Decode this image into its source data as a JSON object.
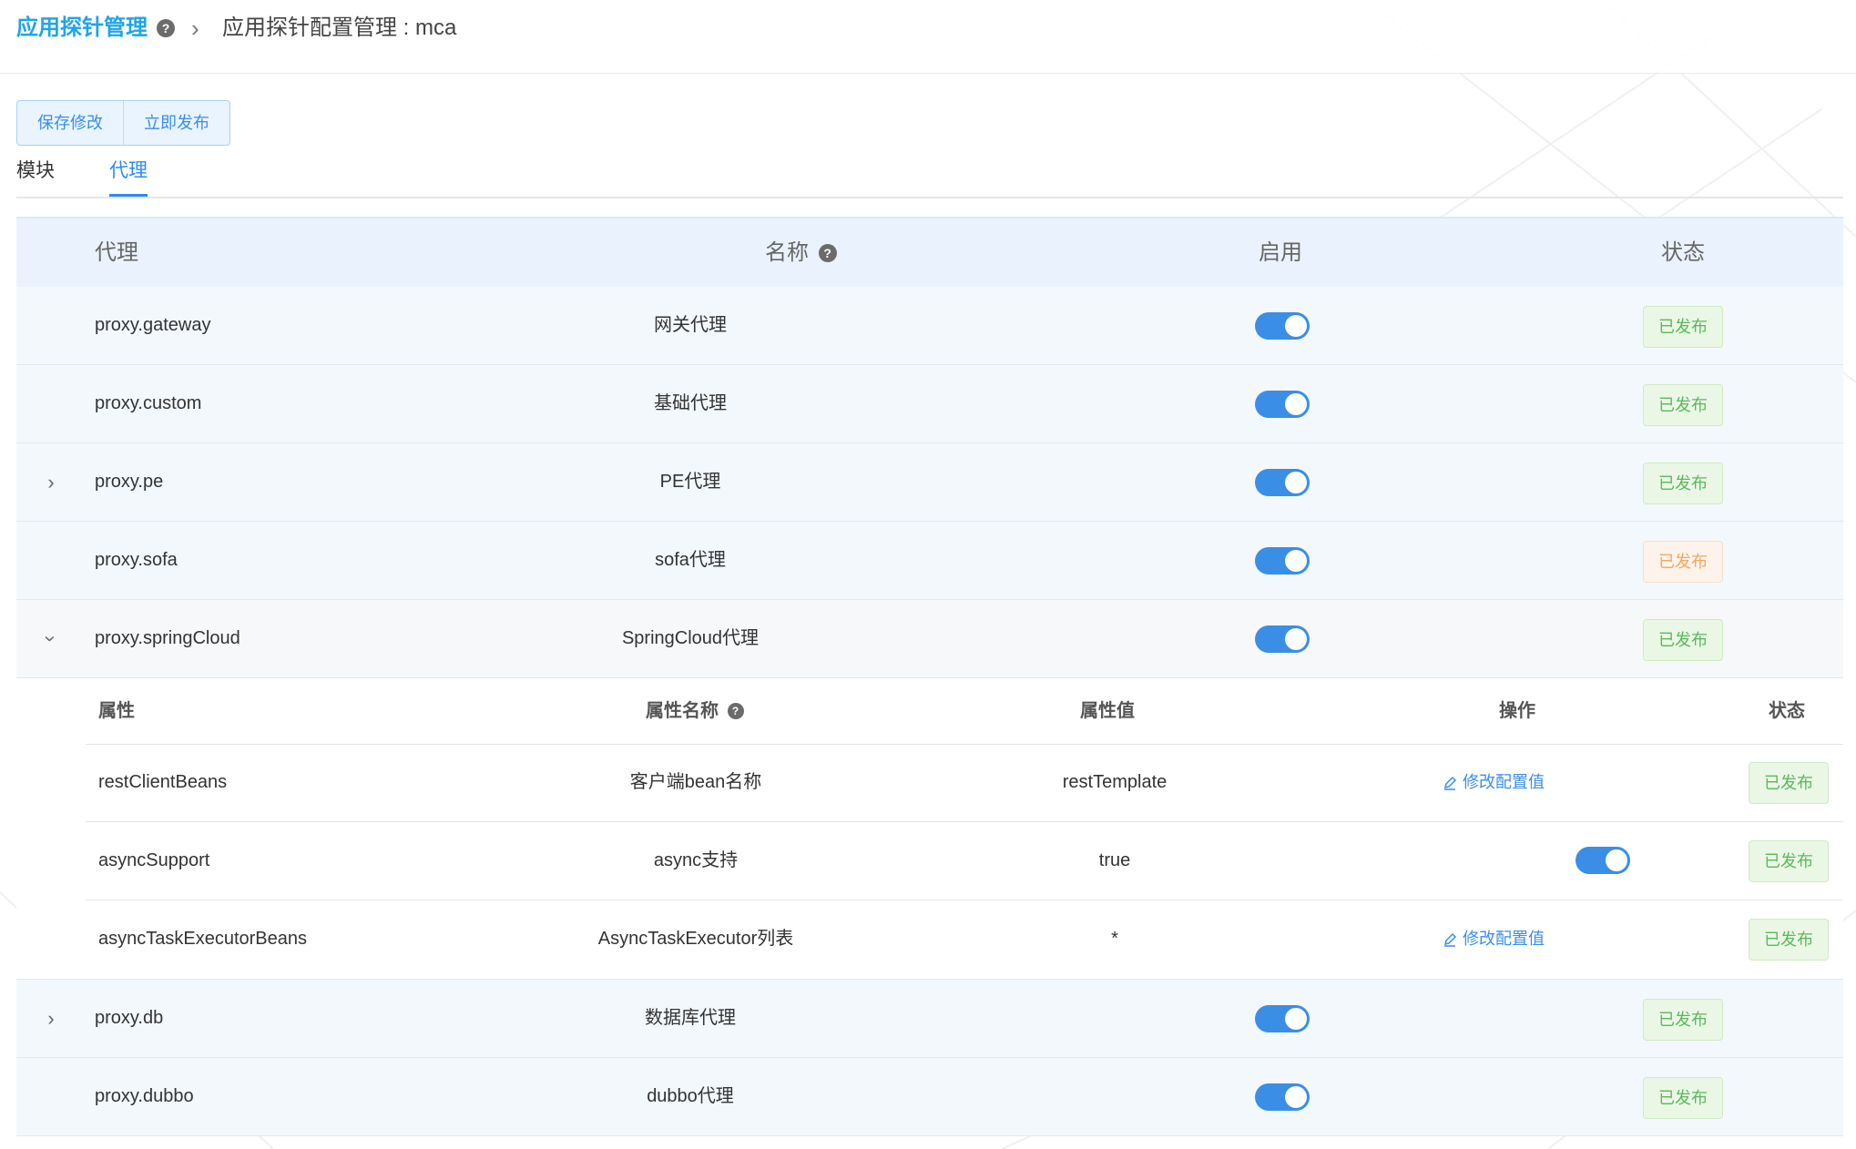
{
  "breadcrumb": {
    "root": "应用探针管理",
    "help_icon": "question-circle-icon",
    "separator": "›",
    "current": "应用探针配置管理 : mca"
  },
  "toolbar": {
    "save_label": "保存修改",
    "publish_label": "立即发布"
  },
  "tabs": [
    {
      "label": "模块",
      "active": false
    },
    {
      "label": "代理",
      "active": true
    }
  ],
  "table": {
    "headers": {
      "proxy": "代理",
      "name": "名称",
      "enabled": "启用",
      "status": "状态"
    },
    "rows": [
      {
        "proxy": "proxy.gateway",
        "name": "网关代理",
        "enabled": true,
        "status": "已发布",
        "status_color": "green",
        "expander": ""
      },
      {
        "proxy": "proxy.custom",
        "name": "基础代理",
        "enabled": true,
        "status": "已发布",
        "status_color": "green",
        "expander": ""
      },
      {
        "proxy": "proxy.pe",
        "name": "PE代理",
        "enabled": true,
        "status": "已发布",
        "status_color": "green",
        "expander": "collapsed"
      },
      {
        "proxy": "proxy.sofa",
        "name": "sofa代理",
        "enabled": true,
        "status": "已发布",
        "status_color": "orange",
        "expander": ""
      },
      {
        "proxy": "proxy.springCloud",
        "name": "SpringCloud代理",
        "enabled": true,
        "status": "已发布",
        "status_color": "green",
        "expander": "expanded"
      },
      {
        "proxy": "proxy.db",
        "name": "数据库代理",
        "enabled": true,
        "status": "已发布",
        "status_color": "green",
        "expander": "collapsed"
      },
      {
        "proxy": "proxy.dubbo",
        "name": "dubbo代理",
        "enabled": true,
        "status": "已发布",
        "status_color": "green",
        "expander": ""
      }
    ]
  },
  "subtable": {
    "headers": {
      "attr": "属性",
      "attr_name": "属性名称",
      "value": "属性值",
      "op": "操作",
      "status": "状态"
    },
    "rows": [
      {
        "attr": "restClientBeans",
        "attr_name": "客户端bean名称",
        "value": "restTemplate",
        "op": "修改配置值",
        "op_type": "link",
        "status": "已发布"
      },
      {
        "attr": "asyncSupport",
        "attr_name": "async支持",
        "value": "true",
        "op": "",
        "op_type": "switch",
        "status": "已发布"
      },
      {
        "attr": "asyncTaskExecutorBeans",
        "attr_name": "AsyncTaskExecutor列表",
        "value": "*",
        "op": "修改配置值",
        "op_type": "link",
        "status": "已发布"
      }
    ]
  },
  "colors": {
    "accent": "#3a8ee6",
    "brand": "#1fa4e8",
    "published_green": "#5cb85c",
    "published_orange": "#f0a95e",
    "header_bg": "#eaf3fd"
  }
}
